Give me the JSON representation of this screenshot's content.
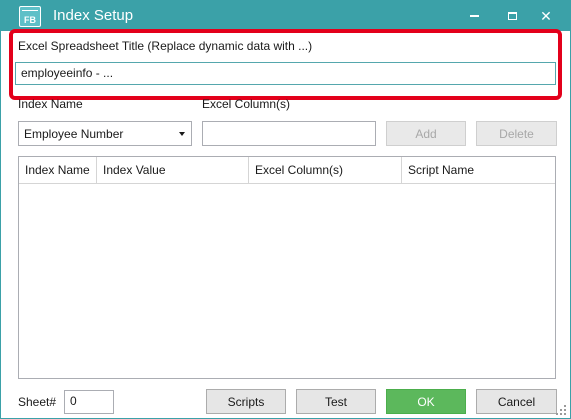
{
  "window": {
    "title": "Index Setup",
    "app_icon_text": "FB",
    "titlebar_color": "#3ba1a8",
    "controls": [
      "minimize-icon",
      "maximize-icon",
      "close-icon"
    ],
    "close_glyph": "✕"
  },
  "spreadsheet_title": {
    "label": "Excel Spreadsheet Title  (Replace dynamic data with ...)",
    "value": "employeeinfo - ...",
    "highlight_color": "#e3001b"
  },
  "index_form": {
    "index_name_label": "Index Name",
    "excel_columns_label": "Excel Column(s)",
    "index_name_selected": "Employee Number",
    "excel_columns_value": "",
    "add_label": "Add",
    "delete_label": "Delete"
  },
  "grid": {
    "columns": [
      "Index Name",
      "Index Value",
      "Excel Column(s)",
      "Script Name"
    ],
    "rows": []
  },
  "footer": {
    "sheet_label": "Sheet#",
    "sheet_value": "0",
    "scripts_label": "Scripts",
    "test_label": "Test",
    "ok_label": "OK",
    "cancel_label": "Cancel",
    "ok_color": "#5cb85c"
  }
}
